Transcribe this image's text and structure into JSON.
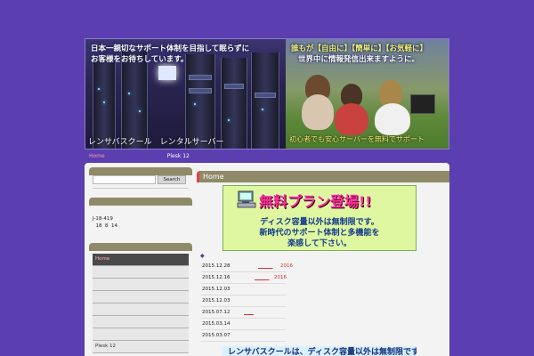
{
  "banner": {
    "left_text_line1": "日本一親切なサポート体制を目指して眠らずに",
    "left_text_line2": "お客様をお待ちしています。",
    "left_caption": "レンサバスクール　レンタルサーバー",
    "right_text_line1": "誰もが【自由に】【簡単に】【お気軽に】",
    "right_text_line2": "世界中に情報発信出来ますように。",
    "right_caption": "初心者でも安心サーバーを無料でサポート"
  },
  "topnav": {
    "home": "Home",
    "plesk": "Plesk 12"
  },
  "sidebar": {
    "search_button": "Search",
    "info_text": "J-18-419\n  18  8  14",
    "menu": [
      "Home",
      "",
      "",
      "",
      "",
      "",
      "",
      "Plesk 12"
    ]
  },
  "content": {
    "heading": "Home",
    "promo_title": "無料プラン登場!!",
    "promo_line1": "ディスク容量以外は無制限です。",
    "promo_line2": "新時代のサポート体制と多機能を",
    "promo_line3": "楽感して下さい。",
    "diamond": "◆",
    "news": [
      {
        "date": "2015.12.28",
        "link": "2016"
      },
      {
        "date": "2015.12.16",
        "link": "2016"
      },
      {
        "date": "2015.12.03",
        "link": ""
      },
      {
        "date": "2015.12.03",
        "link": ""
      },
      {
        "date": "2015.07.12",
        "link": ""
      },
      {
        "date": "2015.03.14",
        "link": ""
      },
      {
        "date": "2015.03.07",
        "link": ""
      }
    ],
    "bottom_text": "レンサバスクールは、ディスク容量以外は無制限です。"
  },
  "colors": {
    "background": "#5b3fb0",
    "widget_header": "#8f8a68",
    "promo_bg": "#dff7a0",
    "promo_title": "#ff2fa0"
  }
}
